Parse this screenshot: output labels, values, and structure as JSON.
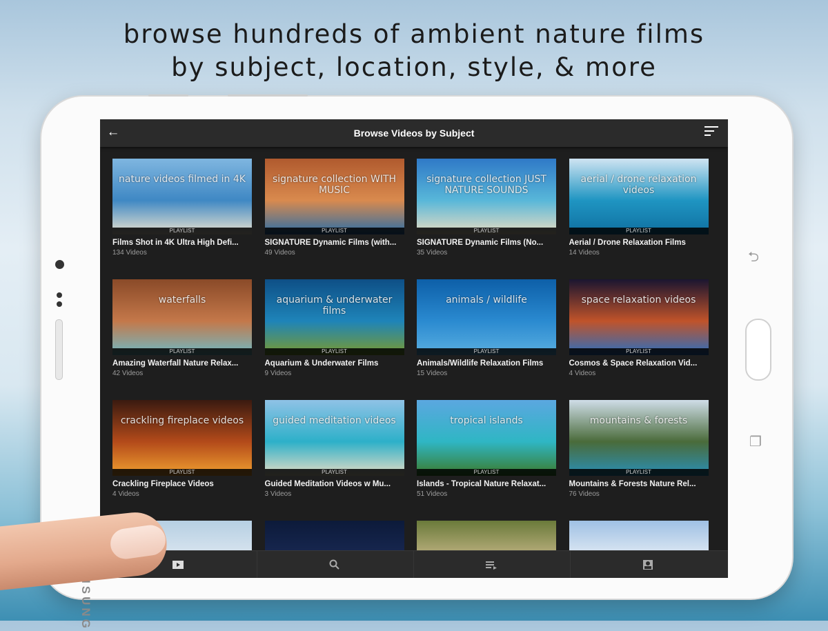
{
  "headline": {
    "line1": "browse hundreds of ambient nature films",
    "line2": "by subject, location, style, & more"
  },
  "device": {
    "brand": "SAMSUNG"
  },
  "app": {
    "title": "Browse Videos by Subject",
    "back_icon": "back-arrow-icon",
    "sort_icon": "sort-icon"
  },
  "cards": [
    {
      "title": "Films Shot in 4K Ultra High Defi...",
      "count": "134 Videos",
      "overlay": "nature videos filmed in 4K",
      "badge": "PLAYLIST",
      "colors": [
        "#7fb6e0",
        "#3f88c4",
        "#e9e2cf"
      ]
    },
    {
      "title": "SIGNATURE Dynamic Films (with...",
      "count": "49 Videos",
      "overlay": "signature collection  WITH MUSIC",
      "badge": "PLAYLIST",
      "colors": [
        "#b05a2e",
        "#d98a4e",
        "#2a6ea8"
      ]
    },
    {
      "title": "SIGNATURE Dynamic Films (No...",
      "count": "35 Videos",
      "overlay": "signature collection  JUST NATURE SOUNDS",
      "badge": "PLAYLIST",
      "colors": [
        "#2f79c7",
        "#58b7d9",
        "#e8dcc2"
      ]
    },
    {
      "title": "Aerial / Drone Relaxation Films",
      "count": "14 Videos",
      "overlay": "aerial / drone relaxation videos",
      "badge": "PLAYLIST",
      "colors": [
        "#cfe4f2",
        "#1f95c2",
        "#0f6fa0"
      ]
    },
    {
      "title": "Amazing Waterfall Nature Relax...",
      "count": "42 Videos",
      "overlay": "waterfalls",
      "badge": "PLAYLIST",
      "colors": [
        "#8a4a28",
        "#c4784a",
        "#6fb9c4"
      ]
    },
    {
      "title": "Aquarium & Underwater Films",
      "count": "9 Videos",
      "overlay": "aquarium & underwater films",
      "badge": "PLAYLIST",
      "colors": [
        "#0e4f86",
        "#1e84b9",
        "#7a9a2e"
      ]
    },
    {
      "title": "Animals/Wildlife Relaxation Films",
      "count": "15 Videos",
      "overlay": "animals / wildlife",
      "badge": "PLAYLIST",
      "colors": [
        "#0d5fa8",
        "#2a8ad0",
        "#5aaee0"
      ]
    },
    {
      "title": "Cosmos & Space Relaxation Vid...",
      "count": "4 Videos",
      "overlay": "space relaxation videos",
      "badge": "PLAYLIST",
      "colors": [
        "#1a1530",
        "#c0532a",
        "#2a6fc0"
      ]
    },
    {
      "title": "Crackling Fireplace Videos",
      "count": "4 Videos",
      "overlay": "crackling fireplace videos",
      "badge": "PLAYLIST",
      "colors": [
        "#3a1a10",
        "#b34a1a",
        "#f0a030"
      ]
    },
    {
      "title": "Guided Meditation Videos w Mu...",
      "count": "3 Videos",
      "overlay": "guided meditation videos",
      "badge": "PLAYLIST",
      "colors": [
        "#8fc2e6",
        "#2db0c9",
        "#e6dcc4"
      ]
    },
    {
      "title": "Islands - Tropical Nature Relaxat...",
      "count": "51 Videos",
      "overlay": "tropical islands",
      "badge": "PLAYLIST",
      "colors": [
        "#5ba7e0",
        "#2fb6c4",
        "#3b7a2a"
      ]
    },
    {
      "title": "Mountains & Forests Nature Rel...",
      "count": "76 Videos",
      "overlay": "mountains & forests",
      "badge": "PLAYLIST",
      "colors": [
        "#cfdde8",
        "#4a6b3a",
        "#2a8fb6"
      ]
    },
    {
      "title": "",
      "count": "",
      "overlay": "",
      "badge": "",
      "colors": [
        "#b6cfe3",
        "#dfe9f1",
        "#9fb9cf"
      ]
    },
    {
      "title": "",
      "count": "",
      "overlay": "",
      "badge": "",
      "colors": [
        "#0c1a3a",
        "#1a2a55",
        "#0a1430"
      ]
    },
    {
      "title": "",
      "count": "",
      "overlay": "",
      "badge": "",
      "colors": [
        "#6a7a3a",
        "#c9b98a",
        "#2f4a22"
      ]
    },
    {
      "title": "",
      "count": "",
      "overlay": "",
      "badge": "",
      "colors": [
        "#9fc0e4",
        "#e9f0f6",
        "#5f86b2"
      ]
    }
  ],
  "bottom_nav": [
    {
      "name": "videos-tab",
      "icon": "play-icon"
    },
    {
      "name": "search-tab",
      "icon": "search-icon"
    },
    {
      "name": "playlist-tab",
      "icon": "playlist-icon"
    },
    {
      "name": "account-tab",
      "icon": "account-icon"
    }
  ]
}
